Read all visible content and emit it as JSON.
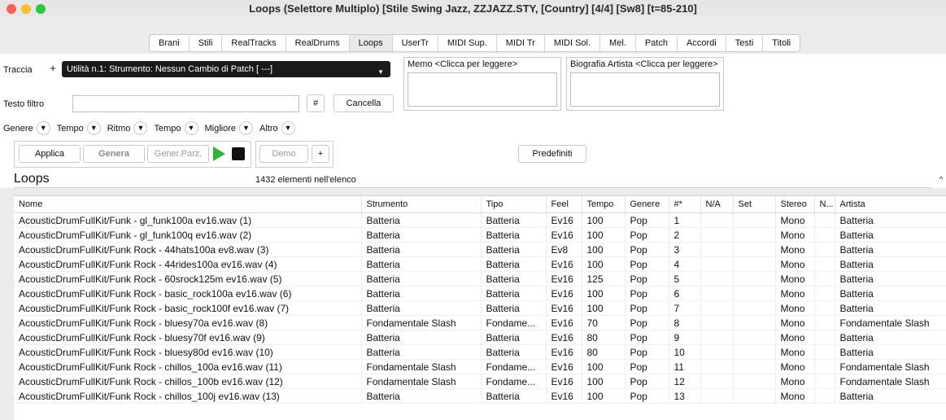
{
  "window": {
    "title": "Loops  (Selettore Multiplo)  [Stile Swing Jazz, ZZJAZZ.STY, [Country] [4/4] [Sw8] [t=85-210]",
    "traffic_colors": [
      "#fe5f57",
      "#febc2e",
      "#28c840"
    ]
  },
  "tabs": [
    "Brani",
    "Stili",
    "RealTracks",
    "RealDrums",
    "Loops",
    "UserTr",
    "MIDI Sup.",
    "MIDI Tr",
    "MIDI Sol.",
    "Mel.",
    "Patch",
    "Accordi",
    "Testi",
    "Titoli"
  ],
  "active_tab": "Loops",
  "track": {
    "label": "Traccia",
    "add_label": "+",
    "selected": "Utilità n.1: Strumento: Nessun Cambio di Patch [ ---]"
  },
  "memo": {
    "title": "Memo  <Clicca per leggere>"
  },
  "bio": {
    "title": "Biografia Artista <Clicca per leggere>"
  },
  "filter": {
    "label": "Testo filtro",
    "value": "",
    "hash_label": "#",
    "clear_label": "Cancella"
  },
  "filters": [
    "Genere",
    "Tempo",
    "Ritmo",
    "Tempo",
    "Migliore",
    "Altro"
  ],
  "actions": {
    "apply": "Applica",
    "generate": "Genera",
    "generate_partial": "Gener.Parz.",
    "demo": "Demo",
    "demo_add": "+",
    "defaults": "Predefiniti"
  },
  "list": {
    "title": "Loops",
    "count_text": "1432 elementi nell'elenco",
    "columns": [
      "Nome",
      "Strumento",
      "Tipo",
      "Feel",
      "Tempo",
      "Genere",
      "#*",
      "N/A",
      "Set",
      "Stereo",
      "N...",
      "Artista"
    ],
    "rows": [
      [
        "AcousticDrumFullKit/Funk - gl_funk100a ev16.wav  (1)",
        "Batteria",
        "Batteria",
        "Ev16",
        "100",
        "Pop",
        "1",
        "",
        "",
        "Mono",
        "",
        "Batteria"
      ],
      [
        "AcousticDrumFullKit/Funk - gl_funk100q ev16.wav  (2)",
        "Batteria",
        "Batteria",
        "Ev16",
        "100",
        "Pop",
        "2",
        "",
        "",
        "Mono",
        "",
        "Batteria"
      ],
      [
        "AcousticDrumFullKit/Funk Rock - 44hats100a ev8.wav  (3)",
        "Batteria",
        "Batteria",
        "Ev8",
        "100",
        "Pop",
        "3",
        "",
        "",
        "Mono",
        "",
        "Batteria"
      ],
      [
        "AcousticDrumFullKit/Funk Rock - 44rides100a ev16.wav  (4)",
        "Batteria",
        "Batteria",
        "Ev16",
        "100",
        "Pop",
        "4",
        "",
        "",
        "Mono",
        "",
        "Batteria"
      ],
      [
        "AcousticDrumFullKit/Funk Rock - 60srock125m ev16.wav  (5)",
        "Batteria",
        "Batteria",
        "Ev16",
        "125",
        "Pop",
        "5",
        "",
        "",
        "Mono",
        "",
        "Batteria"
      ],
      [
        "AcousticDrumFullKit/Funk Rock - basic_rock100a ev16.wav  (6)",
        "Batteria",
        "Batteria",
        "Ev16",
        "100",
        "Pop",
        "6",
        "",
        "",
        "Mono",
        "",
        "Batteria"
      ],
      [
        "AcousticDrumFullKit/Funk Rock - basic_rock100f ev16.wav  (7)",
        "Batteria",
        "Batteria",
        "Ev16",
        "100",
        "Pop",
        "7",
        "",
        "",
        "Mono",
        "",
        "Batteria"
      ],
      [
        "AcousticDrumFullKit/Funk Rock - bluesy70a ev16.wav  (8)",
        "Fondamentale Slash",
        "Fondame...",
        "Ev16",
        "70",
        "Pop",
        "8",
        "",
        "",
        "Mono",
        "",
        "Fondamentale Slash"
      ],
      [
        "AcousticDrumFullKit/Funk Rock - bluesy70f ev16.wav  (9)",
        "Batteria",
        "Batteria",
        "Ev16",
        "80",
        "Pop",
        "9",
        "",
        "",
        "Mono",
        "",
        "Batteria"
      ],
      [
        "AcousticDrumFullKit/Funk Rock - bluesy80d ev16.wav  (10)",
        "Batteria",
        "Batteria",
        "Ev16",
        "80",
        "Pop",
        "10",
        "",
        "",
        "Mono",
        "",
        "Batteria"
      ],
      [
        "AcousticDrumFullKit/Funk Rock - chillos_100a ev16.wav  (11)",
        "Fondamentale Slash",
        "Fondame...",
        "Ev16",
        "100",
        "Pop",
        "11",
        "",
        "",
        "Mono",
        "",
        "Fondamentale Slash"
      ],
      [
        "AcousticDrumFullKit/Funk Rock - chillos_100b ev16.wav  (12)",
        "Fondamentale Slash",
        "Fondame...",
        "Ev16",
        "100",
        "Pop",
        "12",
        "",
        "",
        "Mono",
        "",
        "Fondamentale Slash"
      ],
      [
        "AcousticDrumFullKit/Funk Rock - chillos_100j ev16.wav  (13)",
        "Batteria",
        "Batteria",
        "Ev16",
        "100",
        "Pop",
        "13",
        "",
        "",
        "Mono",
        "",
        "Batteria"
      ]
    ]
  },
  "icons": {
    "play": "play-icon",
    "stop": "stop-icon",
    "collapse": "chevron-up-icon"
  },
  "colors": {
    "play": "#34b233",
    "dropdown_bg": "#1a1a1a"
  }
}
